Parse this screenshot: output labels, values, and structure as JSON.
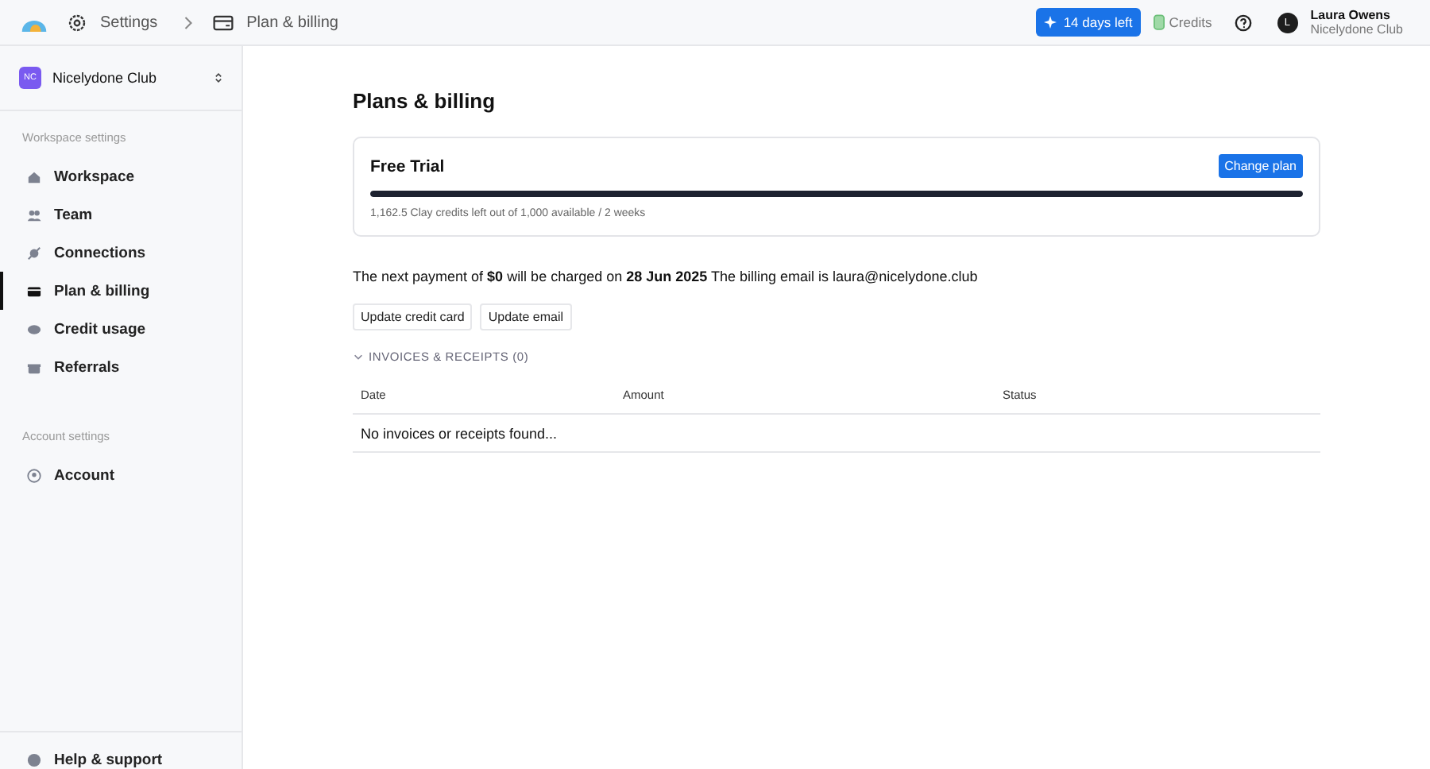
{
  "breadcrumbs": [
    {
      "label": "Settings",
      "kind": "settings"
    },
    {
      "label": "Plan & billing",
      "kind": "billing"
    }
  ],
  "topbar": {
    "trial_badge": "14 days left",
    "credits": "Credits",
    "user": {
      "initial": "L",
      "name": "Laura Owens",
      "org": "Nicelydone Club"
    }
  },
  "sidebar": {
    "workspace": {
      "initials": "NC",
      "name": "Nicelydone Club"
    },
    "sections": [
      {
        "heading": "Workspace settings",
        "items": [
          {
            "label": "Workspace",
            "kind": "home",
            "selected": false
          },
          {
            "label": "Team",
            "kind": "team",
            "selected": false
          },
          {
            "label": "Connections",
            "kind": "plug",
            "selected": false
          },
          {
            "label": "Plan & billing",
            "kind": "card",
            "selected": true
          },
          {
            "label": "Credit usage",
            "kind": "coins",
            "selected": false
          },
          {
            "label": "Referrals",
            "kind": "gift",
            "selected": false
          }
        ]
      },
      {
        "heading": "Account settings",
        "items": [
          {
            "label": "Account",
            "kind": "user",
            "selected": false
          }
        ]
      }
    ],
    "footer_item": "Help & support"
  },
  "page": {
    "title": "Plans & billing",
    "plan": {
      "name": "Free Trial",
      "button": "Change plan",
      "level": 1,
      "usage": "1,162.5 Clay credits left out of 1,000 available / 2 weeks"
    },
    "payment_text": "The next payment of **$0** will be charged on **28 Jun 2025** The billing email is laura@nicelydone.club",
    "buttons": [
      "Update credit card",
      "Update email"
    ],
    "invoices": {
      "heading": "INVOICES & RECEIPTS (0)",
      "expanded": true,
      "columns": [
        "Date",
        "Amount",
        "Status"
      ],
      "empty": "No invoices or receipts found..."
    }
  }
}
